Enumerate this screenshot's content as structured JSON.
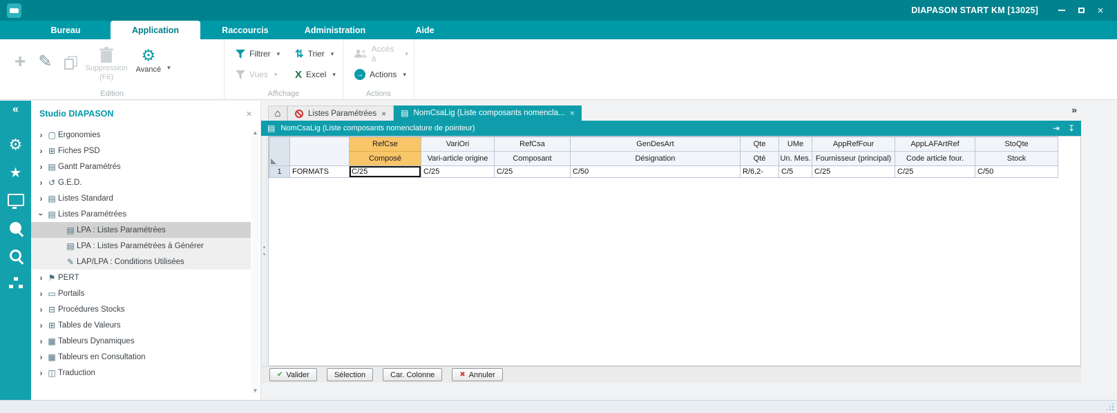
{
  "glyphs": {
    "dropdown": "▾",
    "collapse": "«",
    "overflow": "»",
    "close": "×",
    "home": "⌂",
    "doc": "▤",
    "scroll_up": "▲",
    "scroll_down": "▼",
    "split_up": "▴",
    "split_down": "▾",
    "plus": "+",
    "pencil": "✎",
    "gear": "⚙",
    "star": "★",
    "sort": "⇅",
    "excel": "X",
    "arrow_right": "→",
    "check": "✔",
    "cross": "✖",
    "tree_chevron": "›",
    "export_end": "⇥",
    "export_down": "↧"
  },
  "window": {
    "title": "DIAPASON START KM [13025]"
  },
  "menubar": {
    "items": [
      "Bureau",
      "Application",
      "Raccourcis",
      "Administration",
      "Aide"
    ]
  },
  "ribbon": {
    "edition": {
      "group_label": "Edition",
      "suppression_line1": "Suppression",
      "suppression_line2": "(F6)",
      "avance": "Avancé"
    },
    "affichage": {
      "group_label": "Affichage",
      "filtrer": "Filtrer",
      "trier": "Trier",
      "vues": "Vues",
      "excel": "Excel"
    },
    "actions_group": {
      "group_label": "Actions",
      "acces": "Accès à",
      "actions": "Actions"
    }
  },
  "sidebar": {
    "title": "Studio DIAPASON",
    "items": [
      {
        "label": "Ergonomies",
        "icon": "ergonomies-icon",
        "glyph": "▢"
      },
      {
        "label": "Fiches PSD",
        "icon": "fiches-psd-icon",
        "glyph": "⊞"
      },
      {
        "label": "Gantt Paramétrés",
        "icon": "gantt-icon",
        "glyph": "▤"
      },
      {
        "label": "G.E.D.",
        "icon": "ged-icon",
        "glyph": "↺"
      },
      {
        "label": "Listes Standard",
        "icon": "listes-standard-icon",
        "glyph": "▤"
      },
      {
        "label": "Listes Paramétrées",
        "icon": "listes-parametrees-icon",
        "glyph": "▤"
      },
      {
        "label": "LPA : Listes Paramétrées",
        "icon": "lpa-listes-icon",
        "glyph": "▤"
      },
      {
        "label": "LPA : Listes Paramétrées à Générer",
        "icon": "lpa-generer-icon",
        "glyph": "▤"
      },
      {
        "label": "LAP/LPA : Conditions Utilisées",
        "icon": "conditions-icon",
        "glyph": "✎"
      },
      {
        "label": "PERT",
        "icon": "pert-icon",
        "glyph": "⚑"
      },
      {
        "label": "Portails",
        "icon": "portails-icon",
        "glyph": "▭"
      },
      {
        "label": "Procédures Stocks",
        "icon": "procedures-stocks-icon",
        "glyph": "⊟"
      },
      {
        "label": "Tables de Valeurs",
        "icon": "tables-valeurs-icon",
        "glyph": "⊞"
      },
      {
        "label": "Tableurs Dynamiques",
        "icon": "tableurs-dynamiques-icon",
        "glyph": "▦"
      },
      {
        "label": "Tableurs en Consultation",
        "icon": "tableurs-consultation-icon",
        "glyph": "▦"
      },
      {
        "label": "Traduction",
        "icon": "traduction-icon",
        "glyph": "◫"
      }
    ]
  },
  "tabs": {
    "tab_listes": "Listes Paramétrées",
    "tab_nomcsalig": "NomCsaLig (Liste composants nomencla..."
  },
  "panel": {
    "title": "NomCsaLig (Liste composants nomenclature de pointeur)"
  },
  "grid": {
    "columns": [
      {
        "name": "RefCse",
        "sub": "Composé"
      },
      {
        "name": "VariOri",
        "sub": "Vari-article origine"
      },
      {
        "name": "RefCsa",
        "sub": "Composant"
      },
      {
        "name": "GenDesArt",
        "sub": "Désignation"
      },
      {
        "name": "Qte",
        "sub": "Qté"
      },
      {
        "name": "UMe",
        "sub": "Un. Mes."
      },
      {
        "name": "AppRefFour",
        "sub": "Fournisseur (principal)"
      },
      {
        "name": "AppLAFArtRef",
        "sub": "Code article four."
      },
      {
        "name": "StoQte",
        "sub": "Stock"
      }
    ],
    "row": {
      "num": "1",
      "label": "FORMATS",
      "cells": [
        "C/25",
        "C/25",
        "C/25",
        "C/50",
        "R/6,2-",
        "C/5",
        "C/25",
        "C/25",
        "C/50"
      ]
    }
  },
  "footer": {
    "valider": "Valider",
    "selection": "Sélection",
    "car_colonne": "Car. Colonne",
    "annuler": "Annuler"
  }
}
